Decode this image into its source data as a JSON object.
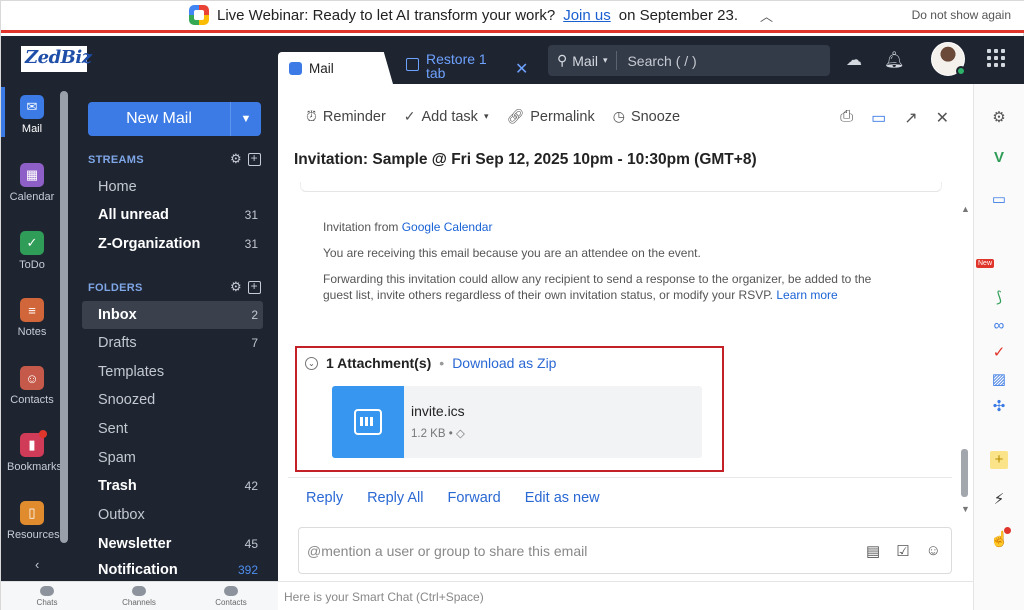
{
  "banner": {
    "text_before": "Live Webinar: Ready to let AI transform your work?",
    "link": "Join us",
    "text_after": "on September 23.",
    "dismiss": "Do not show again"
  },
  "brand": {
    "logo": "ZedBiz"
  },
  "app_nav": {
    "items": [
      {
        "label": "Mail",
        "icon": "mail-icon",
        "color": "#3c7be5",
        "active": true
      },
      {
        "label": "Calendar",
        "icon": "calendar-icon",
        "color": "#8e5fc6"
      },
      {
        "label": "ToDo",
        "icon": "check-icon",
        "color": "#2f9d57"
      },
      {
        "label": "Notes",
        "icon": "notes-icon",
        "color": "#d0663a"
      },
      {
        "label": "Contacts",
        "icon": "contacts-icon",
        "color": "#c65a4a"
      },
      {
        "label": "Bookmarks",
        "icon": "bookmark-icon",
        "color": "#d03b58"
      },
      {
        "label": "Resources",
        "icon": "resources-icon",
        "color": "#e08b2e"
      }
    ],
    "collapse": "‹"
  },
  "bottom_nav": {
    "chats": "Chats",
    "channels": "Channels",
    "contacts": "Contacts"
  },
  "sidebar": {
    "new_mail": "New Mail",
    "streams_header": "STREAMS",
    "streams": [
      {
        "label": "Home",
        "count": ""
      },
      {
        "label": "All unread",
        "count": "31"
      },
      {
        "label": "Z-Organization",
        "count": "31"
      }
    ],
    "folders_header": "FOLDERS",
    "folders": [
      {
        "label": "Inbox",
        "count": "2"
      },
      {
        "label": "Drafts",
        "count": "7"
      },
      {
        "label": "Templates",
        "count": ""
      },
      {
        "label": "Snoozed",
        "count": ""
      },
      {
        "label": "Sent",
        "count": ""
      },
      {
        "label": "Spam",
        "count": ""
      },
      {
        "label": "Trash",
        "count": "42"
      },
      {
        "label": "Outbox",
        "count": ""
      },
      {
        "label": "Newsletter",
        "count": "45"
      },
      {
        "label": "Notification",
        "count": "392"
      }
    ]
  },
  "tabs": {
    "mail": "Mail",
    "restore": "Restore 1 tab"
  },
  "search": {
    "scope": "Mail",
    "placeholder": "Search ( / )"
  },
  "toolbar": {
    "reminder": "Reminder",
    "add_task": "Add task",
    "permalink": "Permalink",
    "snooze": "Snooze"
  },
  "email": {
    "subject": "Invitation: Sample @ Fri Sep 12, 2025 10pm - 10:30pm (GMT+8)",
    "invitation_from_prefix": "Invitation from",
    "invitation_from_link": "Google Calendar",
    "line2": "You are receiving this email because you are an attendee on the event.",
    "line3": "Forwarding this invitation could allow any recipient to send a response to the organizer, be added to the guest list, invite others regardless of their own invitation status, or modify your RSVP.",
    "learn_more": "Learn more"
  },
  "attachments": {
    "count_label": "1 Attachment(s)",
    "download_zip": "Download as Zip",
    "file_name": "invite.ics",
    "file_size": "1.2 KB"
  },
  "actions": {
    "reply": "Reply",
    "reply_all": "Reply All",
    "forward": "Forward",
    "edit_as_new": "Edit as new"
  },
  "comment": {
    "placeholder": "@mention a user or group to share this email"
  },
  "smart_chat": {
    "placeholder": "Here is your Smart Chat (Ctrl+Space)"
  },
  "right_rail": {
    "new_badge": "New"
  }
}
